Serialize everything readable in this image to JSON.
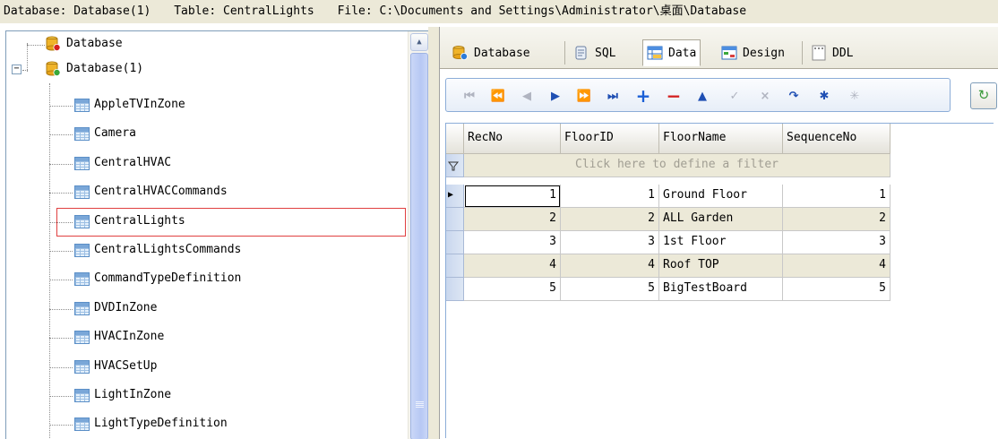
{
  "status_bar": {
    "database": "Database: Database(1)",
    "table": "Table: CentralLights",
    "file": "File: C:\\Documents and Settings\\Administrator\\桌面\\Database"
  },
  "tree": {
    "roots": [
      {
        "label": "Database",
        "icon": "database-red-icon",
        "expanded": false
      },
      {
        "label": "Database(1)",
        "icon": "database-green-icon",
        "expanded": true,
        "expander": "−"
      }
    ],
    "tables": [
      "AppleTVInZone",
      "Camera",
      "CentralHVAC",
      "CentralHVACCommands",
      "CentralLights",
      "CentralLightsCommands",
      "CommandTypeDefinition",
      "DVDInZone",
      "HVACInZone",
      "HVACSetUp",
      "LightInZone",
      "LightTypeDefinition"
    ],
    "selected": "CentralLights",
    "scroll_up_glyph": "▲"
  },
  "tabs": [
    {
      "label": "Database",
      "icon": "database-icon"
    },
    {
      "label": "SQL",
      "icon": "sql-scroll-icon"
    },
    {
      "label": "Data",
      "icon": "data-grid-icon",
      "active": true
    },
    {
      "label": "Design",
      "icon": "design-icon"
    },
    {
      "label": "DDL",
      "icon": "ddl-icon"
    }
  ],
  "navigator": {
    "buttons": [
      {
        "name": "first-record",
        "glyph": "⏮",
        "enabled": false
      },
      {
        "name": "prior-page",
        "glyph": "⏪",
        "enabled": false
      },
      {
        "name": "prior-record",
        "glyph": "◀",
        "enabled": false
      },
      {
        "name": "next-record",
        "glyph": "▶",
        "enabled": true
      },
      {
        "name": "next-page",
        "glyph": "⏩",
        "enabled": true
      },
      {
        "name": "last-record",
        "glyph": "⏭",
        "enabled": true
      },
      {
        "name": "insert-record",
        "glyph": "+",
        "enabled": true
      },
      {
        "name": "delete-record",
        "glyph": "−",
        "enabled": true
      },
      {
        "name": "edit-record",
        "glyph": "▲",
        "enabled": true
      },
      {
        "name": "post-edit",
        "glyph": "✓",
        "enabled": false
      },
      {
        "name": "cancel-edit",
        "glyph": "×",
        "enabled": false
      },
      {
        "name": "refresh-data",
        "glyph": "↷",
        "enabled": true
      },
      {
        "name": "set-bookmark",
        "glyph": "✱",
        "enabled": true
      },
      {
        "name": "goto-bookmark",
        "glyph": "✳",
        "enabled": false
      }
    ],
    "refresh_glyph": "↻"
  },
  "grid": {
    "columns": [
      "RecNo",
      "FloorID",
      "FloorName",
      "SequenceNo"
    ],
    "filter_text": "Click here to define a filter",
    "filter_icon": "funnel-icon",
    "current_row_glyph": "▶",
    "rows": [
      {
        "RecNo": "1",
        "FloorID": "1",
        "FloorName": "Ground Floor",
        "SequenceNo": "1"
      },
      {
        "RecNo": "2",
        "FloorID": "2",
        "FloorName": "ALL Garden",
        "SequenceNo": "2"
      },
      {
        "RecNo": "3",
        "FloorID": "3",
        "FloorName": "1st Floor",
        "SequenceNo": "3"
      },
      {
        "RecNo": "4",
        "FloorID": "4",
        "FloorName": "Roof TOP",
        "SequenceNo": "4"
      },
      {
        "RecNo": "5",
        "FloorID": "5",
        "FloorName": "BigTestBoard",
        "SequenceNo": "5"
      }
    ]
  },
  "colors": {
    "selection_border": "#e04040",
    "alt_row": "#ece9d8",
    "accent_blue": "#1f4fb3",
    "delete_red": "#d42020",
    "disabled": "#b0b4c0"
  }
}
